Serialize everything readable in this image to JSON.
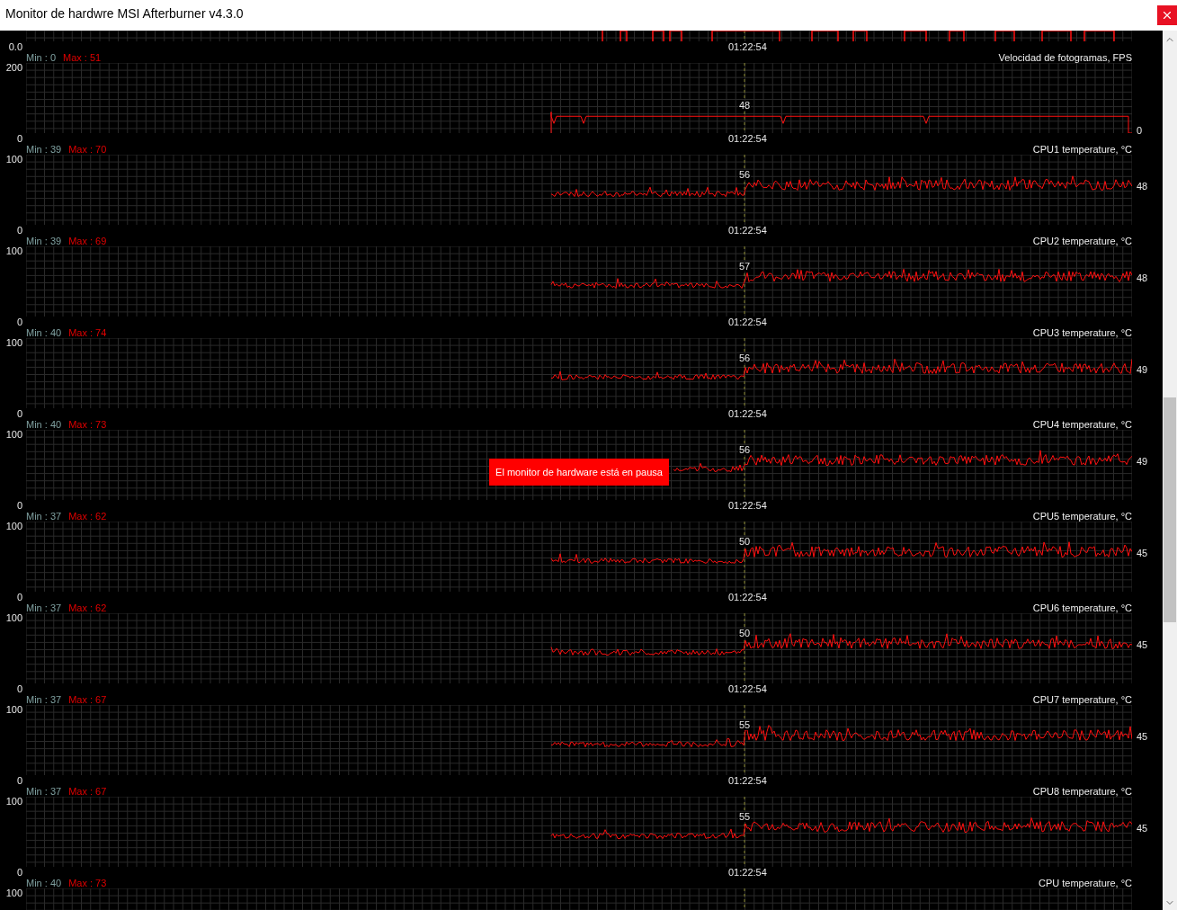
{
  "window": {
    "title": "Monitor de hardwre MSI Afterburner v4.3.0"
  },
  "top_graph": {
    "bottom_label": "0.0",
    "time": "01:22:54"
  },
  "graphs": [
    {
      "kind": "fps",
      "min": "Min : 0",
      "max": "Max : 51",
      "name": "Velocidad de fotogramas, FPS",
      "top_label": "200",
      "bottom_label": "0",
      "cursor_value": "48",
      "last_value": "0",
      "time": "01:22:54"
    },
    {
      "kind": "temperature",
      "min": "Min : 39",
      "max": "Max : 70",
      "name": "CPU1 temperature, °C",
      "top_label": "100",
      "bottom_label": "0",
      "cursor_value": "56",
      "last_value": "48",
      "time": "01:22:54"
    },
    {
      "kind": "temperature",
      "min": "Min : 39",
      "max": "Max : 69",
      "name": "CPU2 temperature, °C",
      "top_label": "100",
      "bottom_label": "0",
      "cursor_value": "57",
      "last_value": "48",
      "time": "01:22:54"
    },
    {
      "kind": "temperature",
      "min": "Min : 40",
      "max": "Max : 74",
      "name": "CPU3 temperature, °C",
      "top_label": "100",
      "bottom_label": "0",
      "cursor_value": "56",
      "last_value": "49",
      "time": "01:22:54"
    },
    {
      "kind": "temperature",
      "min": "Min : 40",
      "max": "Max : 73",
      "name": "CPU4 temperature, °C",
      "top_label": "100",
      "bottom_label": "0",
      "cursor_value": "56",
      "last_value": "49",
      "time": "01:22:54",
      "notice": "El monitor de hardware está en pausa"
    },
    {
      "kind": "temperature",
      "min": "Min : 37",
      "max": "Max : 62",
      "name": "CPU5 temperature, °C",
      "top_label": "100",
      "bottom_label": "0",
      "cursor_value": "50",
      "last_value": "45",
      "time": "01:22:54"
    },
    {
      "kind": "temperature",
      "min": "Min : 37",
      "max": "Max : 62",
      "name": "CPU6 temperature, °C",
      "top_label": "100",
      "bottom_label": "0",
      "cursor_value": "50",
      "last_value": "45",
      "time": "01:22:54"
    },
    {
      "kind": "temperature",
      "min": "Min : 37",
      "max": "Max : 67",
      "name": "CPU7 temperature, °C",
      "top_label": "100",
      "bottom_label": "0",
      "cursor_value": "55",
      "last_value": "45",
      "time": "01:22:54"
    },
    {
      "kind": "temperature",
      "min": "Min : 37",
      "max": "Max : 67",
      "name": "CPU8 temperature, °C",
      "top_label": "100",
      "bottom_label": "0",
      "cursor_value": "55",
      "last_value": "45",
      "time": "01:22:54"
    }
  ],
  "partial_graph": {
    "min": "Min : 40",
    "max": "Max : 73",
    "name": "CPU temperature, °C",
    "top_label": "100"
  }
}
